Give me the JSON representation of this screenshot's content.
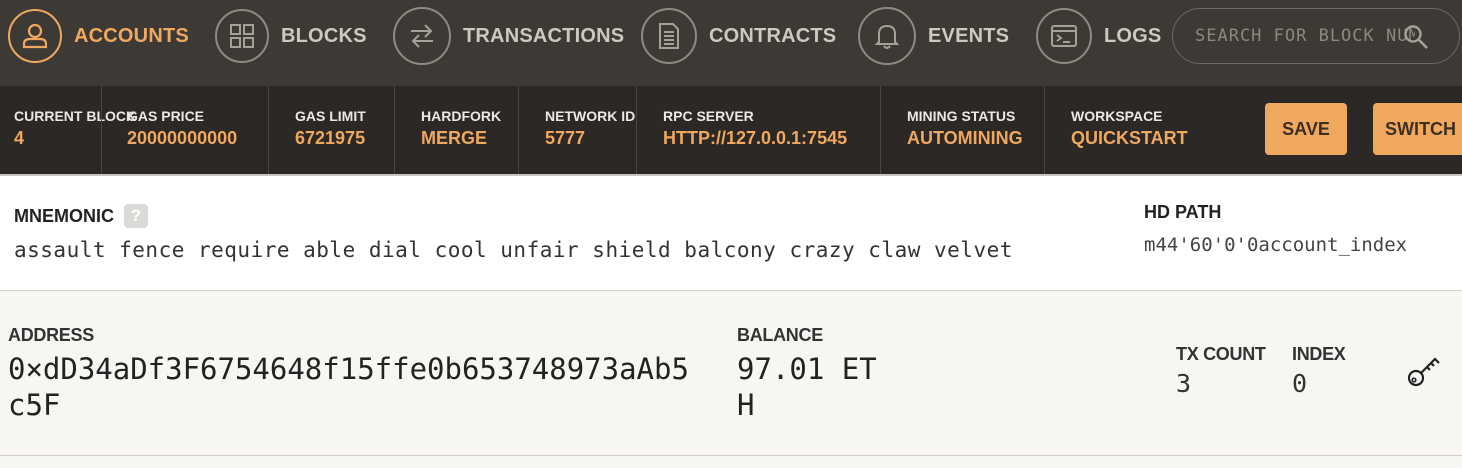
{
  "nav": {
    "items": [
      {
        "label": "ACCOUNTS",
        "icon": "person-icon",
        "active": true
      },
      {
        "label": "BLOCKS",
        "icon": "grid-icon",
        "active": false
      },
      {
        "label": "TRANSACTIONS",
        "icon": "swap-arrows-icon",
        "active": false
      },
      {
        "label": "CONTRACTS",
        "icon": "document-icon",
        "active": false
      },
      {
        "label": "EVENTS",
        "icon": "bell-icon",
        "active": false
      },
      {
        "label": "LOGS",
        "icon": "terminal-icon",
        "active": false
      }
    ],
    "search_placeholder": "SEARCH FOR BLOCK NUMBERS OR TX HASHES"
  },
  "status": {
    "current_block_label": "CURRENT BLOCK",
    "current_block": "4",
    "gas_price_label": "GAS PRICE",
    "gas_price": "20000000000",
    "gas_limit_label": "GAS LIMIT",
    "gas_limit": "6721975",
    "hardfork_label": "HARDFORK",
    "hardfork": "MERGE",
    "network_id_label": "NETWORK ID",
    "network_id": "5777",
    "rpc_label": "RPC SERVER",
    "rpc": "HTTP://127.0.0.1:7545",
    "mining_label": "MINING STATUS",
    "mining": "AUTOMINING",
    "workspace_label": "WORKSPACE",
    "workspace": "QUICKSTART",
    "save_label": "SAVE",
    "switch_label": "SWITCH"
  },
  "mnemonic": {
    "label": "MNEMONIC",
    "help": "?",
    "words": "assault fence require able dial cool unfair shield balcony crazy claw velvet",
    "hd_path_label": "HD PATH",
    "hd_path": "m44'60'0'0account_index"
  },
  "account": {
    "address_label": "ADDRESS",
    "address": "0×dD34aDf3F6754648f15ffe0b653748973aAb5c5F",
    "balance_label": "BALANCE",
    "balance": "97.01 ETH",
    "tx_count_label": "TX COUNT",
    "tx_count": "3",
    "index_label": "INDEX",
    "index": "0"
  },
  "colors": {
    "accent": "#f0a85f",
    "nav_bg": "#3d3935",
    "status_bg": "#2b2825"
  }
}
